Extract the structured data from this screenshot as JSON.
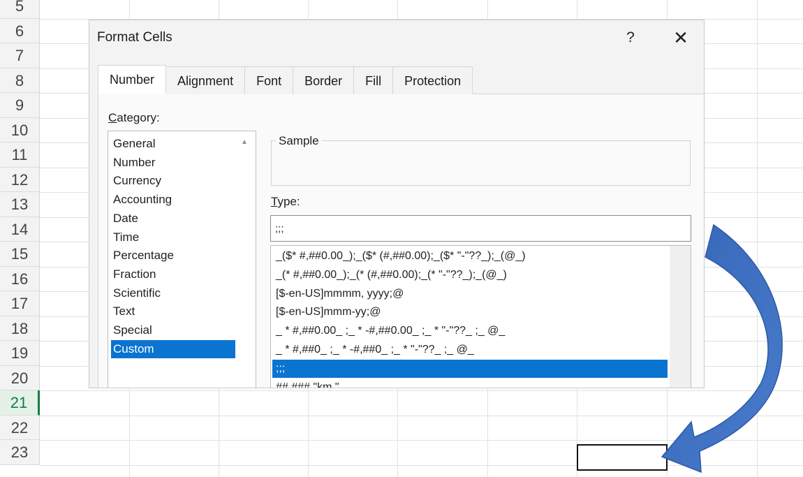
{
  "sheet": {
    "row_numbers": [
      "5",
      "6",
      "7",
      "8",
      "9",
      "10",
      "11",
      "12",
      "13",
      "14",
      "15",
      "16",
      "17",
      "18",
      "19",
      "20",
      "21",
      "22",
      "23"
    ],
    "selected_row": "21"
  },
  "dialog": {
    "title": "Format Cells",
    "help_label": "?",
    "close_label": "✕",
    "tabs": [
      "Number",
      "Alignment",
      "Font",
      "Border",
      "Fill",
      "Protection"
    ],
    "active_tab": "Number",
    "category_label_hotkey": "C",
    "category_label_rest": "ategory:",
    "categories": [
      "General",
      "Number",
      "Currency",
      "Accounting",
      "Date",
      "Time",
      "Percentage",
      "Fraction",
      "Scientific",
      "Text",
      "Special",
      "Custom"
    ],
    "selected_category": "Custom",
    "sample_label": "Sample",
    "type_label_hotkey": "T",
    "type_label_rest": "ype:",
    "type_value": ";;;",
    "type_formats": [
      "_($* #,##0.00_);_($* (#,##0.00);_($* \"-\"??_);_(@_)",
      "_(* #,##0.00_);_(* (#,##0.00);_(* \"-\"??_);_(@_)",
      "[$-en-US]mmmm, yyyy;@",
      "[$-en-US]mmm-yy;@",
      "_ * #,##0.00_ ;_ * -#,##0.00_ ;_ * \"-\"??_ ;_ @_",
      "_ * #,##0_ ;_ * -#,##0_ ;_ * \"-\"??_ ;_ @_",
      ";;;",
      "## ### \"km \""
    ],
    "selected_format": ";;;"
  },
  "colors": {
    "selection": "#0a74d0",
    "arrow": "#3e70c4",
    "row_selected": "#137e43"
  },
  "icons": {
    "arrow": "curved-arrow-icon",
    "close": "close-icon",
    "help": "help-icon"
  }
}
